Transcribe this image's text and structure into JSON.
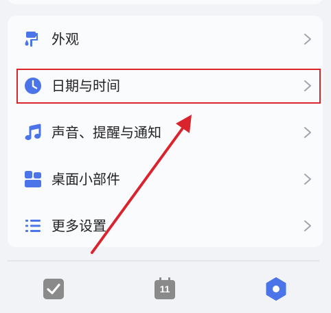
{
  "settings": {
    "items": [
      {
        "label": "外观",
        "icon": "paint-roller-icon"
      },
      {
        "label": "日期与时间",
        "icon": "clock-icon",
        "highlighted": true
      },
      {
        "label": "声音、提醒与通知",
        "icon": "music-note-icon"
      },
      {
        "label": "桌面小部件",
        "icon": "widgets-icon"
      },
      {
        "label": "更多设置",
        "icon": "list-icon"
      }
    ],
    "chevron_icon": "chevron-right-icon"
  },
  "bottom_nav": {
    "tabs": [
      {
        "icon": "checkbox-icon",
        "active": false
      },
      {
        "icon": "calendar-icon",
        "label": "11",
        "active": false
      },
      {
        "icon": "settings-hexagon-icon",
        "active": true
      }
    ]
  },
  "colors": {
    "accent": "#4a74e8",
    "highlight": "#d9232d",
    "inactive_icon": "#8a8a8a",
    "text": "#222222",
    "card": "#fafbfd",
    "background": "#f2f3f7"
  }
}
